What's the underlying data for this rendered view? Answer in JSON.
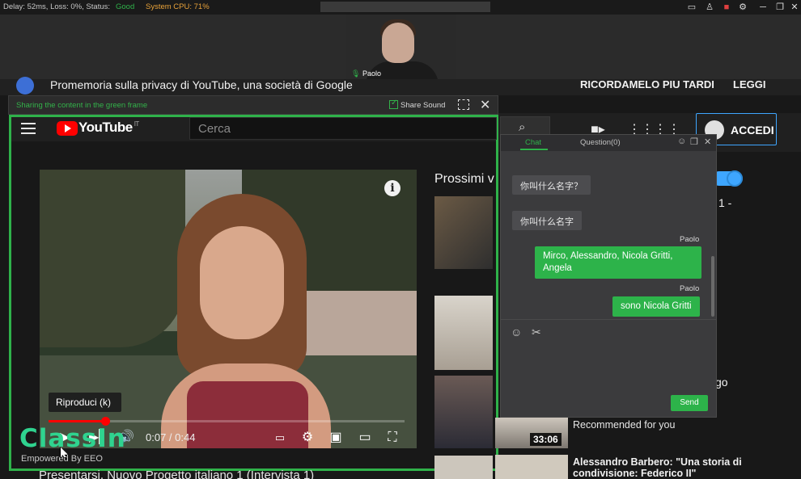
{
  "status_bar": {
    "delay_label": "Delay: 52ms, Loss: 0%, Status:",
    "status_value": "Good",
    "cpu_label": "System CPU: 71%"
  },
  "webcam": {
    "name": "Paolo"
  },
  "youtube": {
    "privacy_notice": "Promemoria sulla privacy di YouTube, una società di Google",
    "remind_later": "RICORDAMELO PIU TARDI",
    "read": "LEGGI",
    "sign_in": "ACCEDI",
    "logo_text": "YouTube",
    "logo_region": "IT",
    "search_placeholder": "Cerca",
    "up_next": "Prossimi v",
    "side_fragment_1": "1 -",
    "side_fragment_2": "go",
    "recommended": "Recommended for you",
    "duration": "33:06",
    "next_title": "Alessandro Barbero: \"Una storia di condivisione: Federico II\"",
    "bottom_title": "Presentarsi, Nuovo Progetto italiano 1 (Intervista 1)"
  },
  "player": {
    "tooltip": "Riproduci (k)",
    "time": "0:07 / 0:44",
    "progress_fraction": 0.16,
    "info": "i"
  },
  "share": {
    "hint": "Sharing the content in the green frame",
    "share_sound": "Share Sound"
  },
  "classin": {
    "logo": "ClassIn",
    "tagline": "Empowered By EEO"
  },
  "chat": {
    "tab_chat": "Chat",
    "tab_question": "Question(0)",
    "send": "Send",
    "messages": [
      {
        "text": "你叫什么名字？"
      },
      {
        "text": "你叫什么名字"
      },
      {
        "sender": "Paolo",
        "text": "Mirco, Alessandro, Nicola Gritti, Angela"
      },
      {
        "sender": "Paolo",
        "text": "sono Nicola Gritti"
      }
    ]
  },
  "colors": {
    "accent_green": "#2fb24a",
    "youtube_red": "#ff0000",
    "status_good": "#2fb24a",
    "cpu_orange": "#e8a23a"
  }
}
